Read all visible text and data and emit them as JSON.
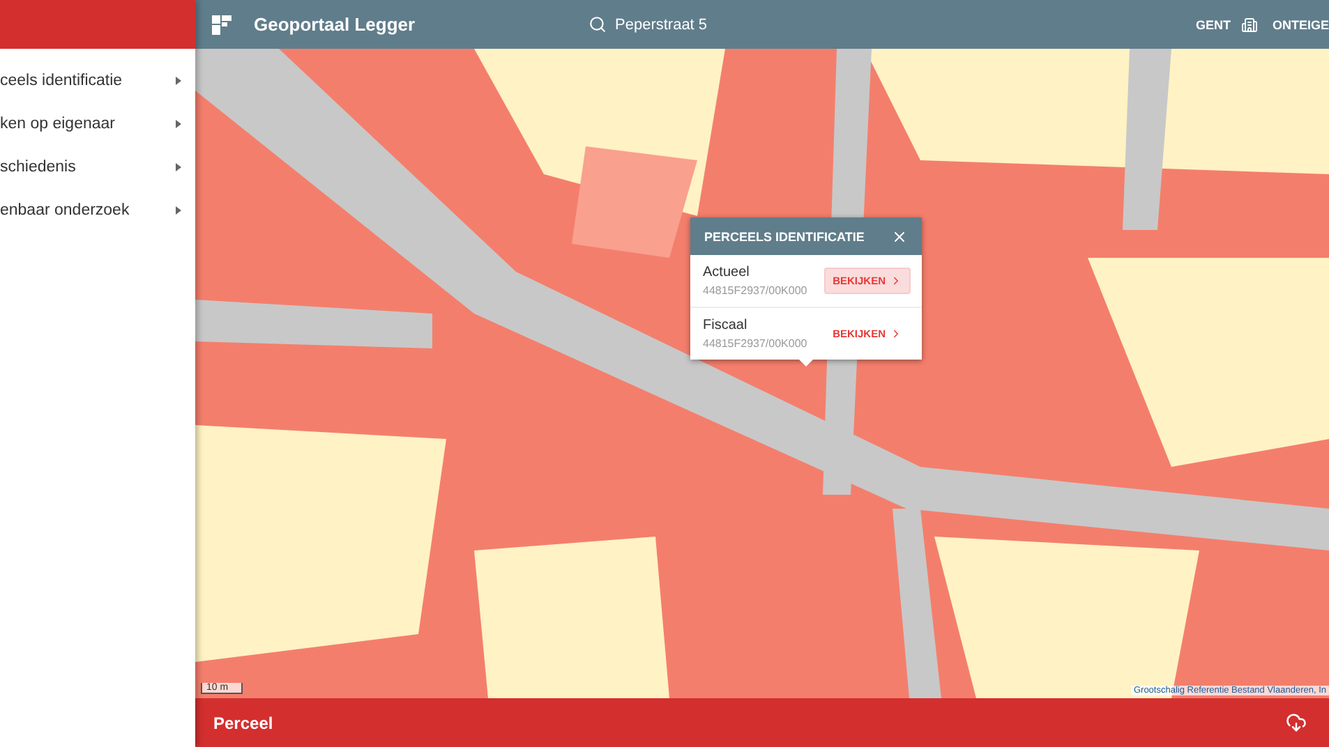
{
  "app": {
    "title": "Geoportaal Legger"
  },
  "search": {
    "value": "Peperstraat 5"
  },
  "header_actions": [
    {
      "label": "GENT",
      "kind": "city"
    },
    {
      "label": "ONTEIGE",
      "kind": "plain"
    }
  ],
  "sidebar": {
    "items": [
      {
        "label": "ceels identificatie"
      },
      {
        "label": "ken op eigenaar"
      },
      {
        "label": "schiedenis"
      },
      {
        "label": "enbaar onderzoek"
      }
    ]
  },
  "map": {
    "scale": "10 m",
    "attribution": "Grootschalig Referentie Bestand Vlaanderen, In"
  },
  "popup": {
    "title": "PERCEELS IDENTIFICATIE",
    "rows": [
      {
        "label": "Actueel",
        "code": "44815F2937/00K000",
        "button": "BEKIJKEN",
        "highlighted": true
      },
      {
        "label": "Fiscaal",
        "code": "44815F2937/00K000",
        "button": "BEKIJKEN",
        "highlighted": false
      }
    ]
  },
  "bottom_bar": {
    "title": "Perceel"
  }
}
